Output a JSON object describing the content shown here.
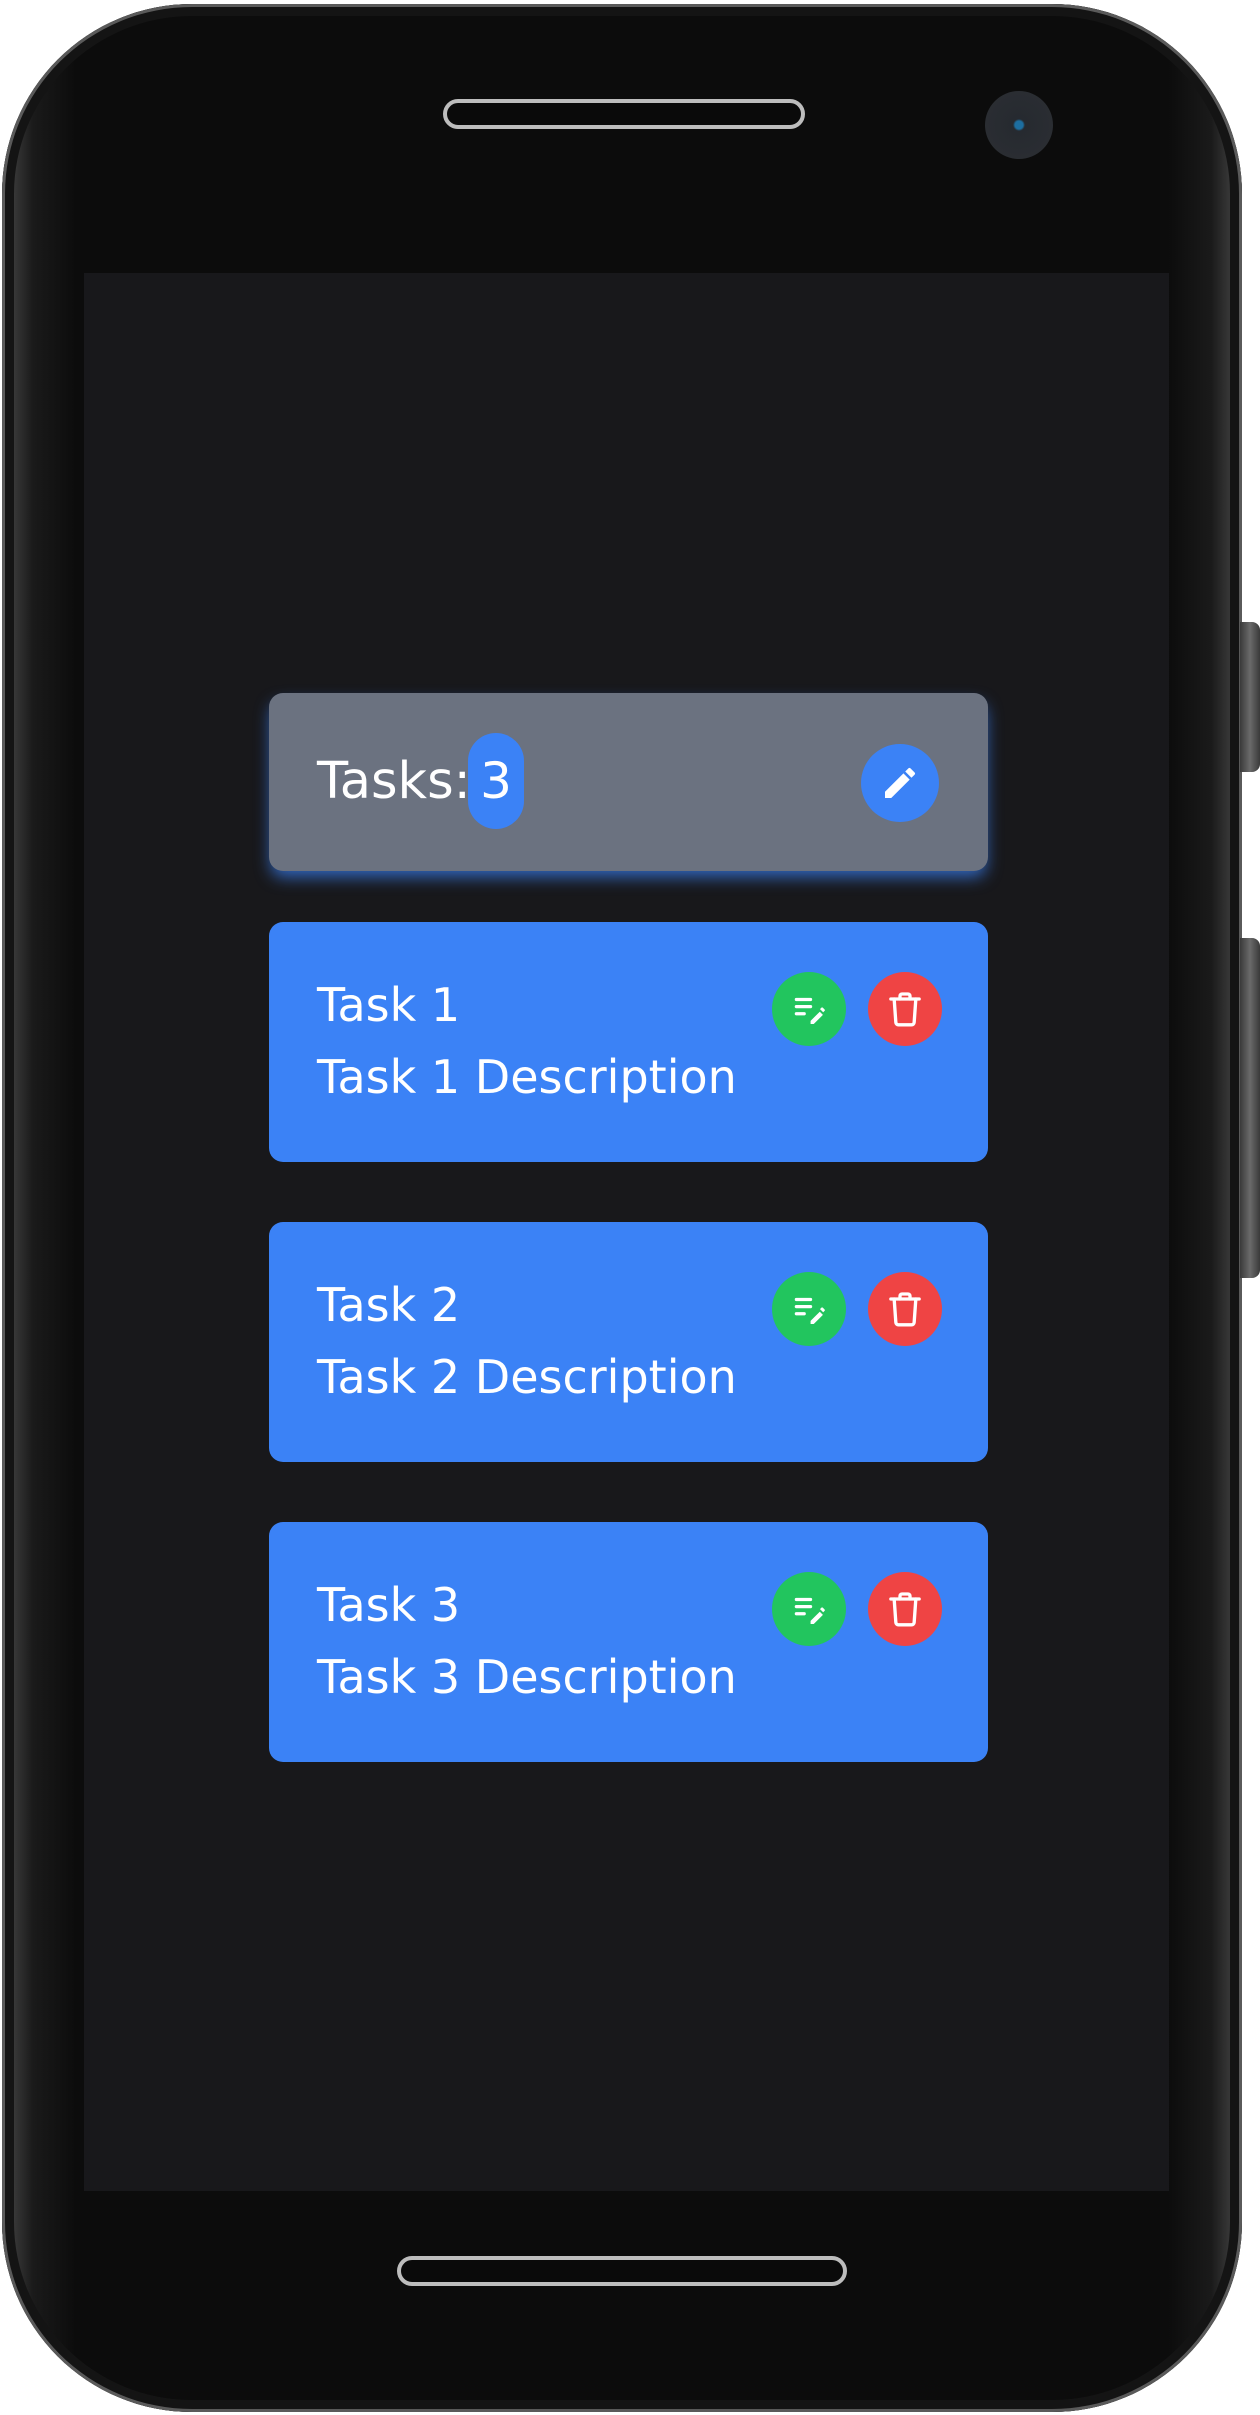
{
  "colors": {
    "screen_background": "#18181b",
    "header_card": "#6b7280",
    "accent_blue": "#3b82f6",
    "edit_green": "#22c55e",
    "delete_red": "#ef4444",
    "text": "#ffffff"
  },
  "header": {
    "label": "Tasks:",
    "count": "3",
    "edit_icon": "pencil-icon"
  },
  "tasks": [
    {
      "title": "Task 1",
      "description": "Task 1 Description",
      "edit_icon": "edit-note-icon",
      "delete_icon": "trash-icon"
    },
    {
      "title": "Task 2",
      "description": "Task 2 Description",
      "edit_icon": "edit-note-icon",
      "delete_icon": "trash-icon"
    },
    {
      "title": "Task 3",
      "description": "Task 3 Description",
      "edit_icon": "edit-note-icon",
      "delete_icon": "trash-icon"
    }
  ]
}
